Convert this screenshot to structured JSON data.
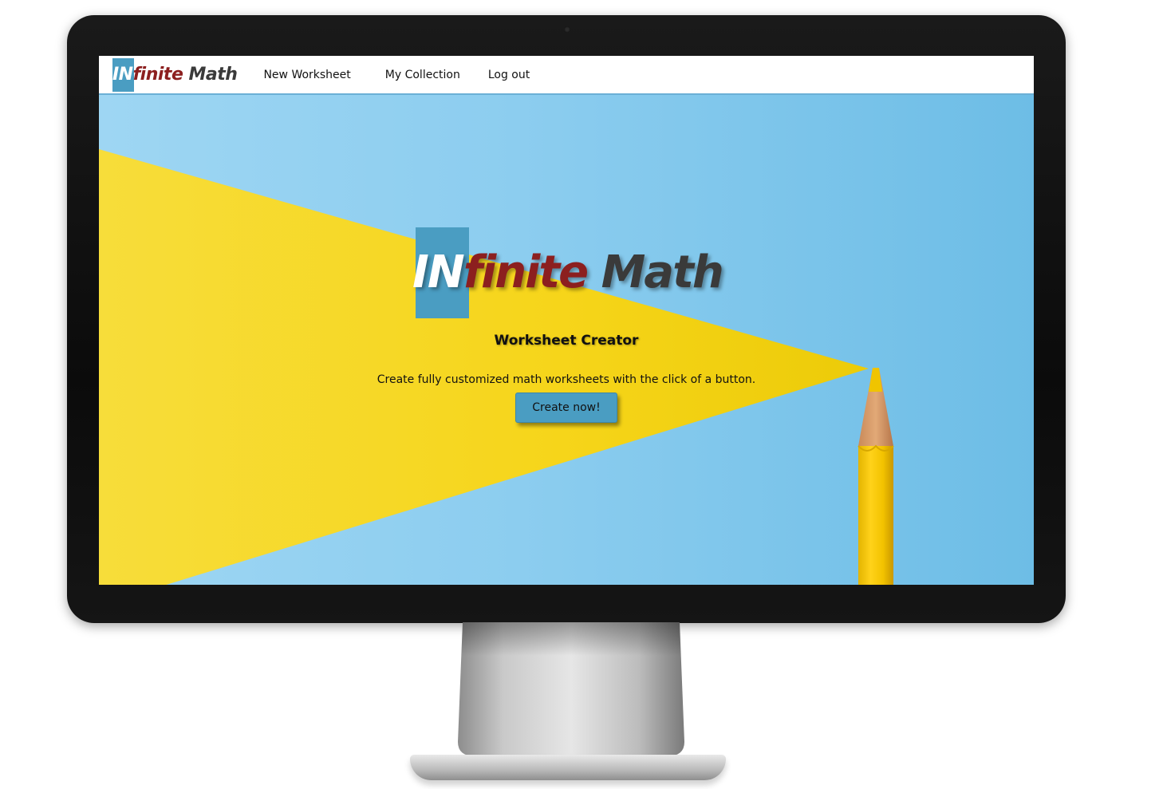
{
  "nav": {
    "logo": {
      "in": "IN",
      "finite": "finite",
      "math": " Math"
    },
    "links": [
      "New Worksheet",
      "My Collection",
      "Log out"
    ]
  },
  "hero": {
    "logo": {
      "in": "IN",
      "finite": "finite",
      "math": " Math"
    },
    "subtitle": "Worksheet Creator",
    "description": "Create fully customized math worksheets with the click of a button.",
    "cta_label": "Create now!"
  },
  "colors": {
    "brand_blue": "#4a9dc2",
    "brand_red": "#8c1f1f",
    "brand_dark": "#3a3a3a",
    "hero_yellow": "#f7d922",
    "hero_blue": "#8ccdef"
  }
}
